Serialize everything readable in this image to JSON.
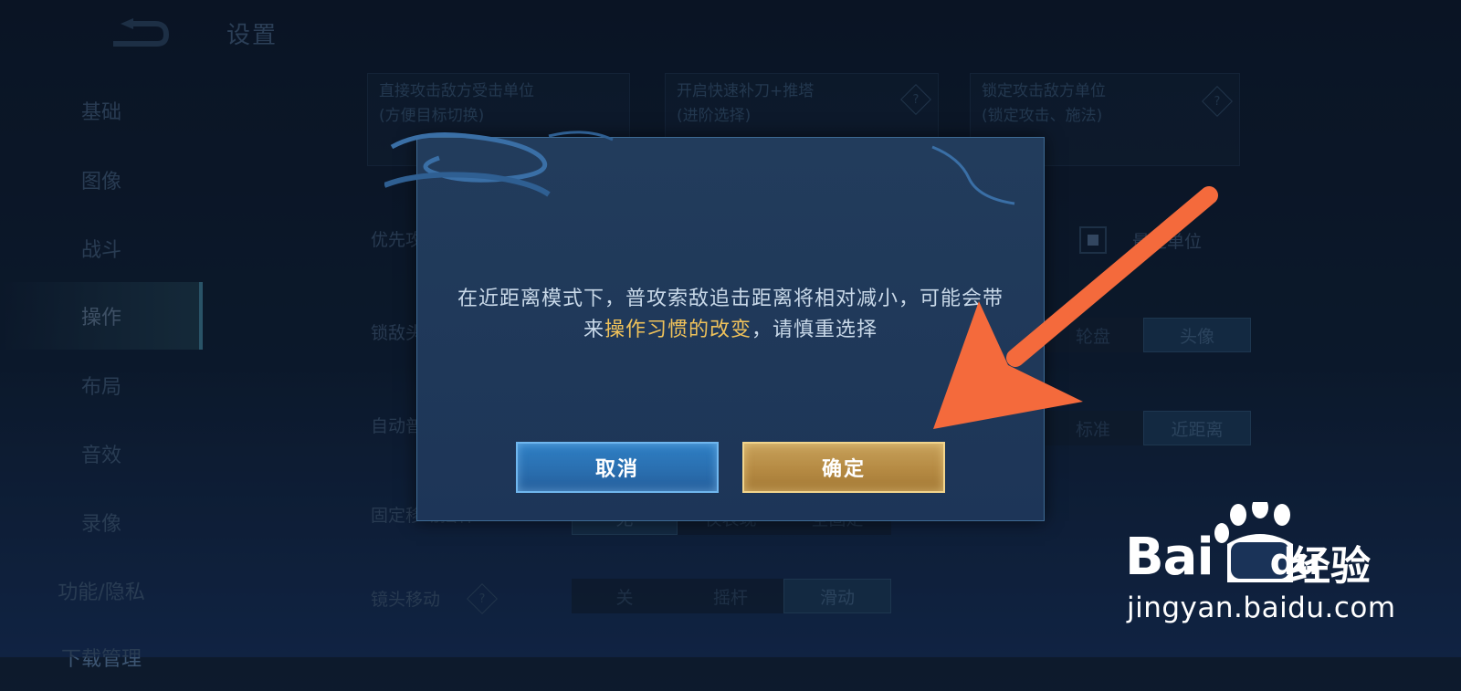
{
  "header": {
    "title": "设置"
  },
  "sidebar": {
    "items": [
      {
        "label": "基础"
      },
      {
        "label": "图像"
      },
      {
        "label": "战斗"
      },
      {
        "label": "操作",
        "active": true
      },
      {
        "label": "布局"
      },
      {
        "label": "音效"
      },
      {
        "label": "录像"
      },
      {
        "label": "功能/隐私"
      },
      {
        "label": "下载管理"
      }
    ]
  },
  "settings": {
    "cards": [
      {
        "line1": "直接攻击敌方受击单位",
        "line2": "(方便目标切换)"
      },
      {
        "line1": "开启快速补刀+推塔",
        "line2": "(进阶选择)"
      },
      {
        "line1": "锁定攻击敌方单位",
        "line2": "(锁定攻击、施法)"
      }
    ],
    "rows": {
      "priority": {
        "label": "优先攻",
        "option": "最近单位"
      },
      "lock": {
        "label": "锁敌头",
        "options": [
          "轮盘",
          "头像"
        ],
        "selected": "头像"
      },
      "auto": {
        "label": "自动普",
        "options": [
          "标准",
          "近距离"
        ],
        "selected": "近距离"
      },
      "fixed_stick": {
        "label": "固定移动摇杆",
        "options": [
          "无",
          "仅表现",
          "全固定"
        ],
        "selected": "无"
      },
      "camera": {
        "label": "镜头移动",
        "options": [
          "关",
          "摇杆",
          "滑动"
        ],
        "selected": "滑动"
      }
    }
  },
  "dialog": {
    "message_part1": "在近距离模式下，普攻索敌追击距离将相对减小，可能会带来",
    "message_highlight": "操作习惯的改变",
    "message_part2": "，请慎重选择",
    "cancel_label": "取消",
    "confirm_label": "确定",
    "highlight_color": "#f0c25a"
  },
  "annotation": {
    "arrow_color": "#f46a3c"
  },
  "watermark": {
    "brand_left": "Bai",
    "brand_right": "du",
    "cn": "经验",
    "url": "jingyan.baidu.com"
  },
  "icons": {
    "back": "back-arrow-icon",
    "help": "help-diamond-icon",
    "paw": "baidu-paw-icon"
  }
}
